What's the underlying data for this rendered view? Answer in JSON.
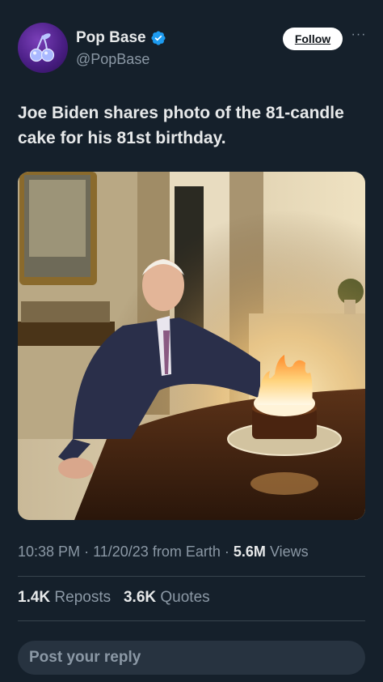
{
  "header": {
    "display_name": "Pop Base",
    "handle": "@PopBase",
    "follow_label": "Follow",
    "more_label": "···",
    "avatar_icon": "cherries-icon",
    "verified_icon": "verified-badge-icon"
  },
  "tweet": {
    "text": "Joe Biden shares photo of the 81-candle cake for his 81st birthday.",
    "photo_icon": "photo-image"
  },
  "meta": {
    "time": "10:38 PM",
    "separator": "·",
    "date": "11/20/23",
    "source": "from Earth",
    "views_count": "5.6M",
    "views_label": "Views"
  },
  "stats": {
    "reposts_count": "1.4K",
    "reposts_label": "Reposts",
    "quotes_count": "3.6K",
    "quotes_label": "Quotes"
  },
  "reply": {
    "placeholder": "Post your reply"
  },
  "colors": {
    "background": "#15202b",
    "text_primary": "#e7e9ea",
    "text_secondary": "#8b98a5",
    "verified_blue": "#1d9bf0",
    "divider": "#38444d"
  }
}
